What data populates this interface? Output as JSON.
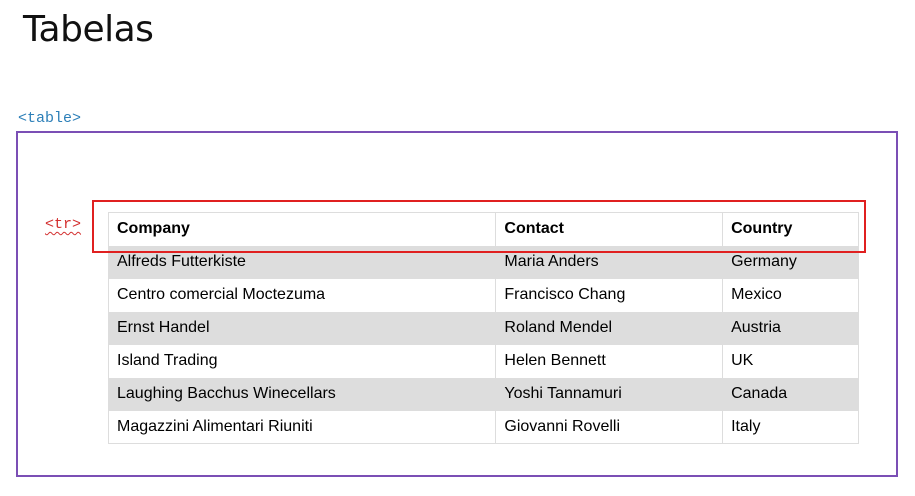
{
  "page": {
    "title": "Tabelas",
    "table_tag": "<table>",
    "row_tag": "<tr>"
  },
  "colors": {
    "table_box_border": "#7b4fb5",
    "row_highlight_border": "#e02020",
    "table_tag_text": "#2c7fb8",
    "row_tag_text": "#d32f2f",
    "striped_row_bg": "#dddddd"
  },
  "table": {
    "headers": [
      "Company",
      "Contact",
      "Country"
    ],
    "rows": [
      [
        "Alfreds Futterkiste",
        "Maria Anders",
        "Germany"
      ],
      [
        "Centro comercial Moctezuma",
        "Francisco Chang",
        "Mexico"
      ],
      [
        "Ernst Handel",
        "Roland Mendel",
        "Austria"
      ],
      [
        "Island Trading",
        "Helen Bennett",
        "UK"
      ],
      [
        "Laughing Bacchus Winecellars",
        "Yoshi Tannamuri",
        "Canada"
      ],
      [
        "Magazzini Alimentari Riuniti",
        "Giovanni Rovelli",
        "Italy"
      ]
    ]
  }
}
